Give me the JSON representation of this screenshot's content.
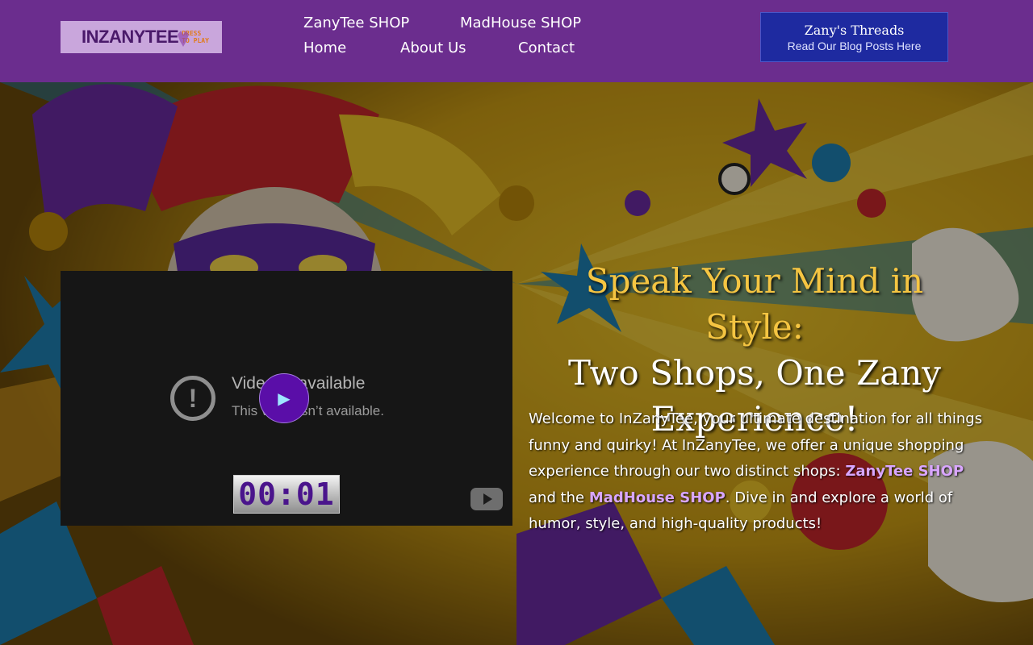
{
  "header": {
    "logo": {
      "main": "INZANYTEE",
      "sub_line1": "DRESS",
      "sub_line2": "TO PLAY"
    },
    "nav": [
      {
        "label": "ZanyTee SHOP"
      },
      {
        "label": "MadHouse SHOP"
      },
      {
        "label": "Home"
      },
      {
        "label": "About Us"
      },
      {
        "label": "Contact"
      }
    ],
    "blog_button": {
      "title": "Zany's Threads",
      "subtitle": "Read Our Blog Posts Here"
    }
  },
  "video": {
    "error_title": "Video unavailable",
    "error_message": "This video isn’t available.",
    "play_symbol": "▶",
    "timer": "00:01",
    "error_icon": "!"
  },
  "hero": {
    "headline_line1": "Speak Your Mind in Style:",
    "headline_line2": "Two Shops, One Zany",
    "headline_line3": "Experience!",
    "intro_part1": "Welcome to InZanyTee, your ultimate destination for all things funny and quirky! At InZanyTee, we offer a unique shopping experience through our two distinct shops: ",
    "intro_link1": "ZanyTee SHOP",
    "intro_part2": " and the ",
    "intro_link2": "MadHouse SHOP",
    "intro_part3": ". Dive in and explore a world of humor, style, and high-quality products!"
  },
  "colors": {
    "header_bg": "#6b2d8e",
    "blog_button_bg": "#1e2aa0",
    "headline_accent": "#f5c542",
    "link": "#d9a6ff",
    "play_button": "#5a0ea8"
  },
  "icons": {
    "error": "alert-circle-icon",
    "play": "play-icon",
    "youtube": "youtube-logo-icon"
  }
}
